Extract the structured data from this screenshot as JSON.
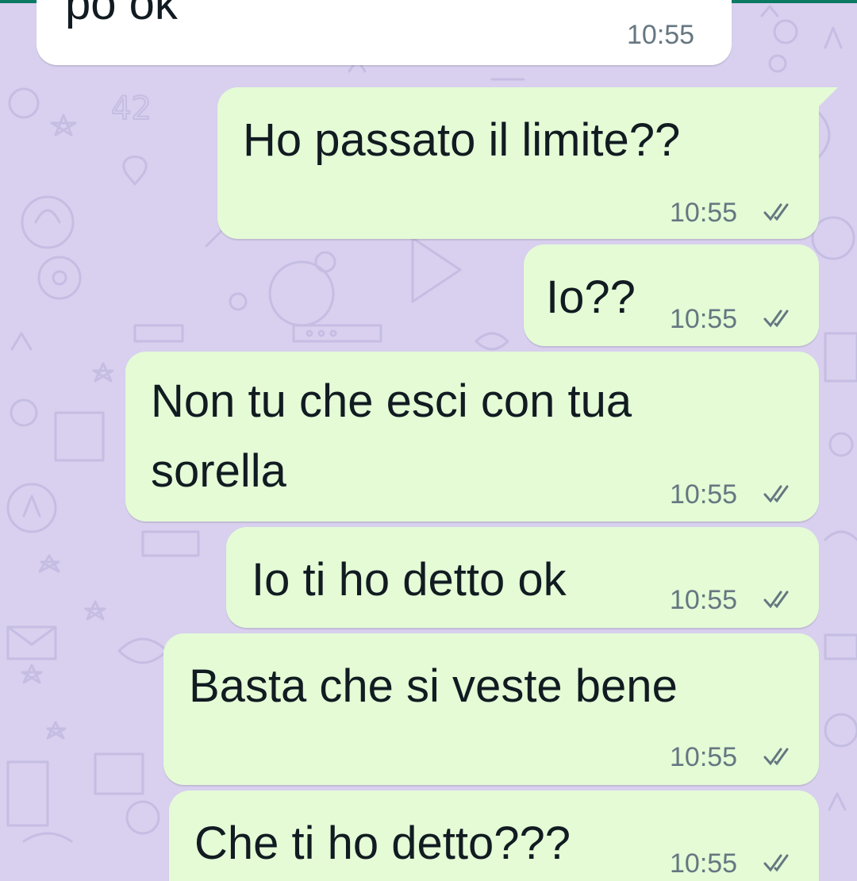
{
  "conversation": {
    "accent_color": "#0b7a62",
    "background_color": "#d8d0ee",
    "incoming_bubble_color": "#ffffff",
    "outgoing_bubble_color": "#e4fbd6",
    "messages": [
      {
        "text": "po ok",
        "time": "10:55",
        "direction": "incoming"
      },
      {
        "text": "Ho passato il limite??",
        "time": "10:55",
        "direction": "outgoing",
        "status": "read-double-check-icon"
      },
      {
        "text": "Io??",
        "time": "10:55",
        "direction": "outgoing",
        "status": "read-double-check-icon"
      },
      {
        "text_line1": "Non tu che esci con tua",
        "text_line2": "sorella",
        "time": "10:55",
        "direction": "outgoing",
        "status": "read-double-check-icon"
      },
      {
        "text": "Io ti ho detto ok",
        "time": "10:55",
        "direction": "outgoing",
        "status": "read-double-check-icon"
      },
      {
        "text": "Basta che si veste bene",
        "time": "10:55",
        "direction": "outgoing",
        "status": "read-double-check-icon"
      },
      {
        "text": "Che ti ho detto???",
        "time": "10:55",
        "direction": "outgoing",
        "status": "read-double-check-icon"
      }
    ]
  }
}
